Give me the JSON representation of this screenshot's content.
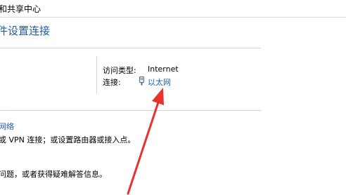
{
  "address_bar": {
    "breadcrumb": "和共享中心"
  },
  "main": {
    "title": "件设置连接",
    "active_network": {
      "access_type_label": "访问类型:",
      "access_type_value": "Internet",
      "connections_label": "连接:",
      "connection_value": "以太网"
    },
    "tasks": {
      "setup_link": "网络",
      "setup_description": "或 VPN 连接；或设置路由器或接入点。",
      "troubleshoot_description": "问题，或者获得疑难解答信息。"
    }
  },
  "colors": {
    "link": "#1a5fb4",
    "title": "#1e5a9c",
    "annotation_arrow": "#e8322f"
  },
  "icons": {
    "ethernet": "ethernet-plug-icon"
  }
}
